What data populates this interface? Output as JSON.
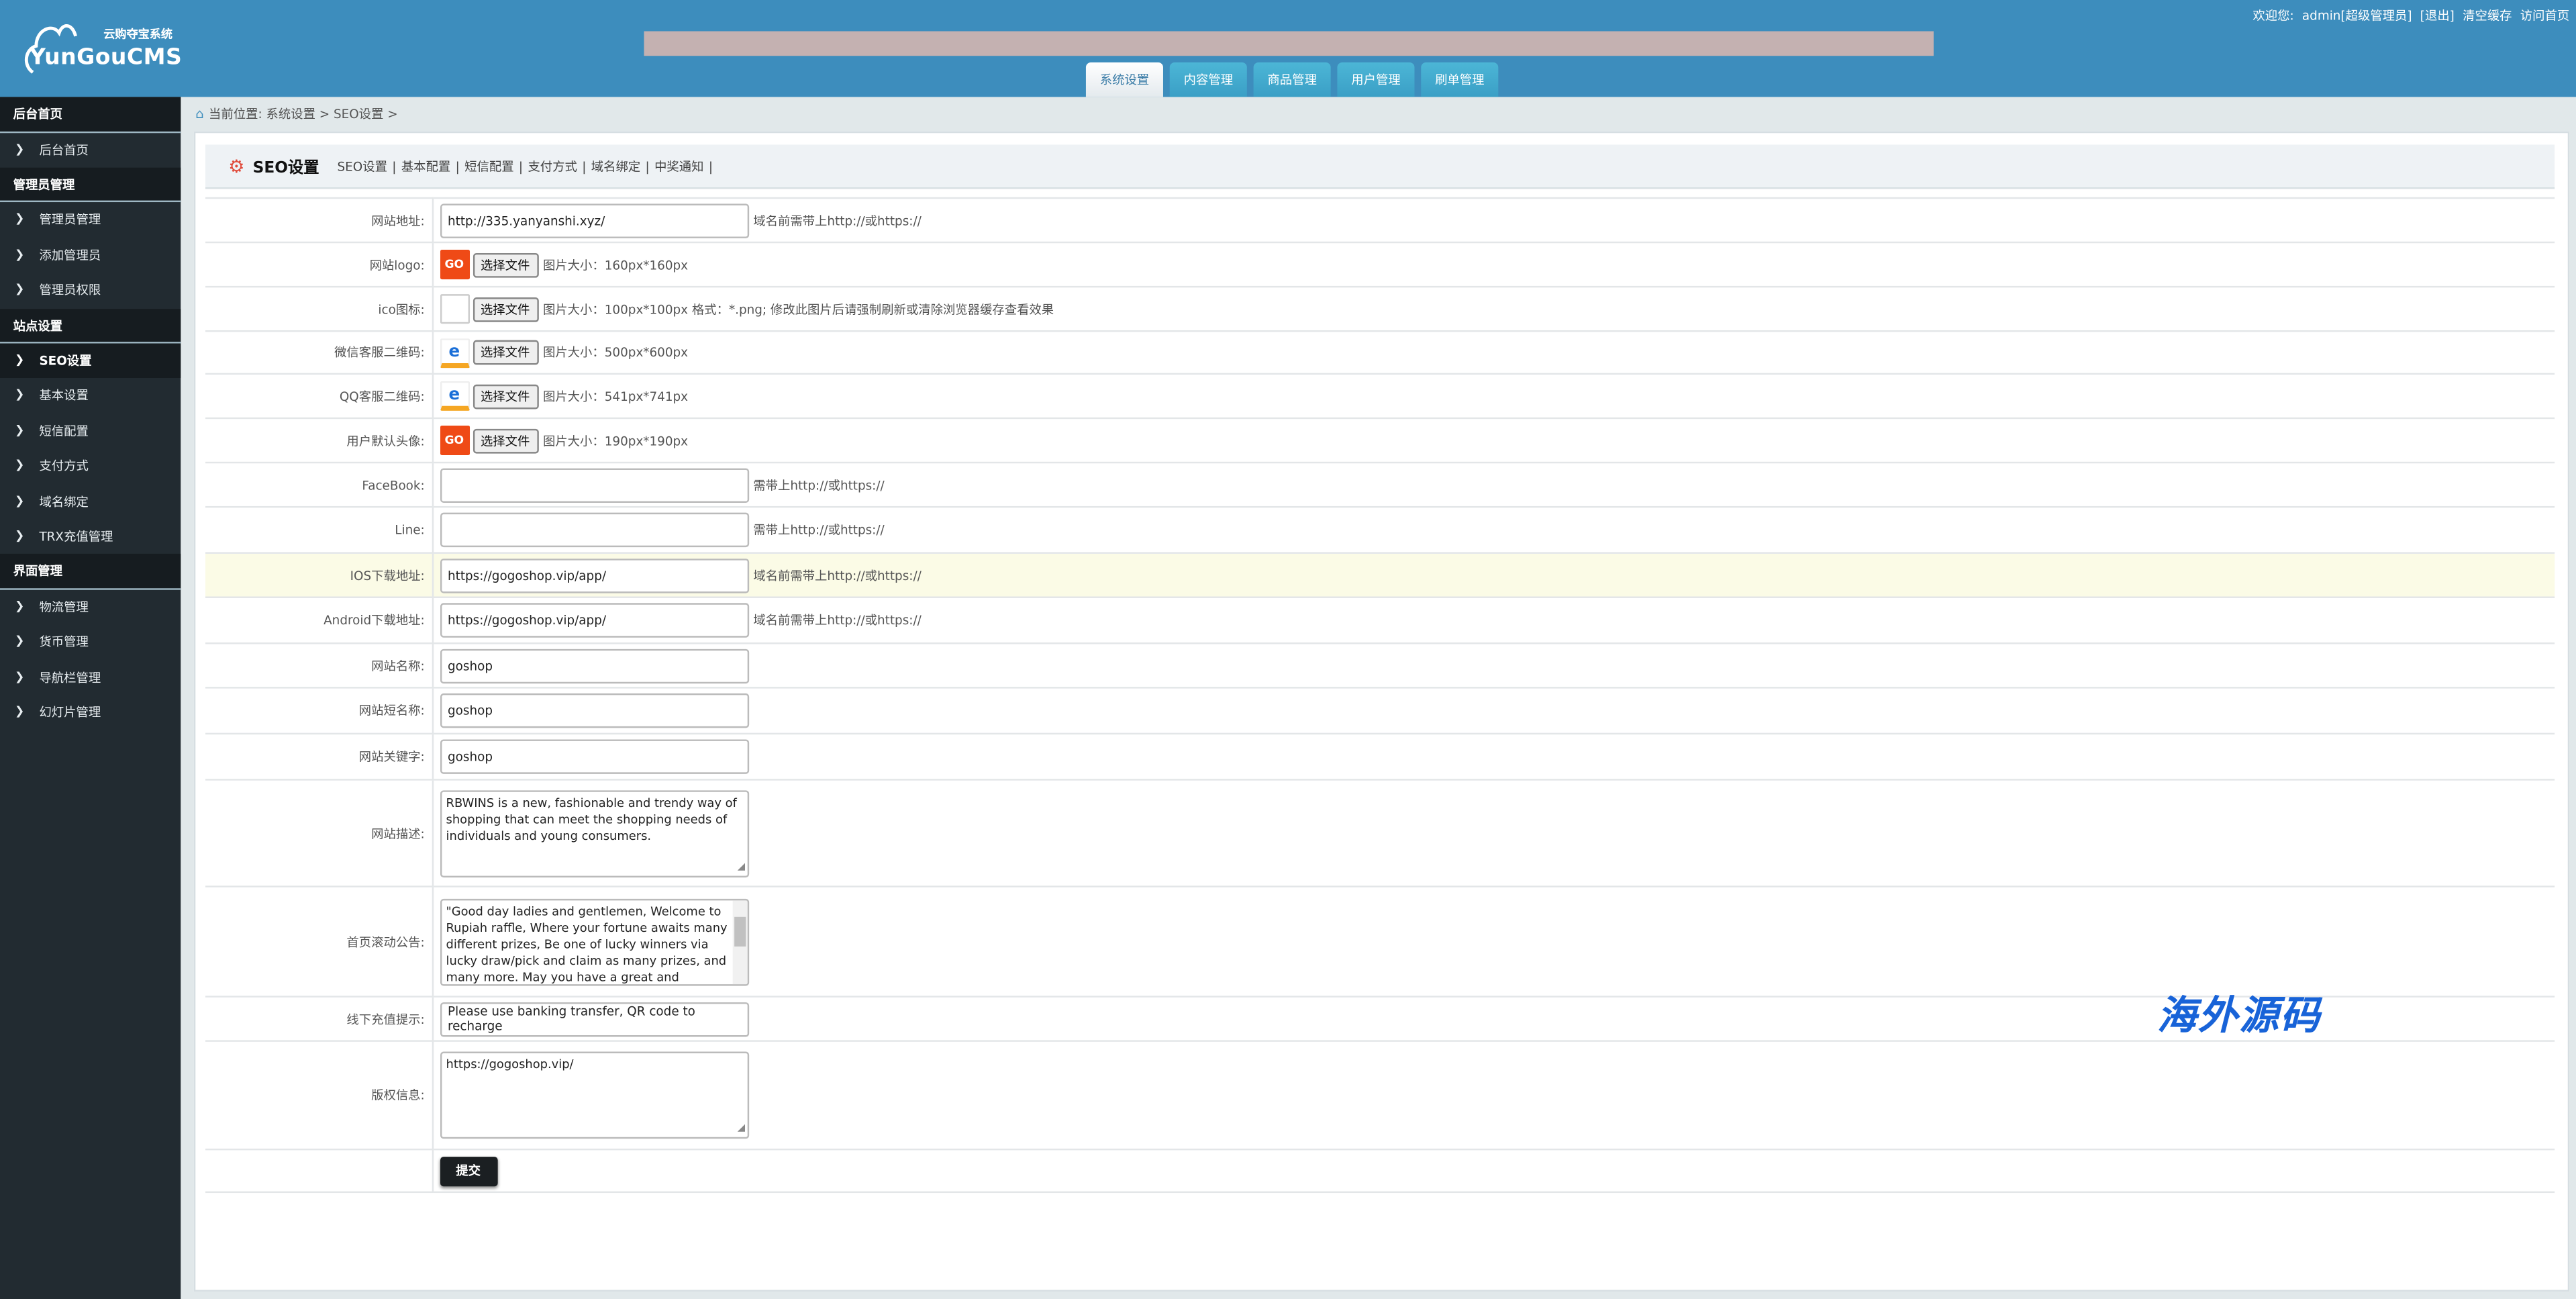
{
  "header": {
    "logo_cn": "云购夺宝系统",
    "logo_en": "YunGouCMS",
    "top_links": [
      "欢迎您:",
      "admin[超级管理员]",
      "[退出]",
      "清空缓存",
      "访问首页"
    ],
    "tabs": [
      {
        "label": "系统设置",
        "active": true
      },
      {
        "label": "内容管理"
      },
      {
        "label": "商品管理"
      },
      {
        "label": "用户管理"
      },
      {
        "label": "刷单管理"
      }
    ],
    "brand_color": "#3d8dbd"
  },
  "sidebar": {
    "sections": [
      {
        "title": "后台首页",
        "items": [
          "后台首页"
        ]
      },
      {
        "title": "管理员管理",
        "items": [
          "管理员管理",
          "添加管理员",
          "管理员权限"
        ]
      },
      {
        "title": "站点设置",
        "items": [
          "SEO设置",
          "基本设置",
          "短信配置",
          "支付方式",
          "域名绑定",
          "TRX充值管理"
        ]
      },
      {
        "title": "界面管理",
        "items": [
          "物流管理",
          "货币管理",
          "导航栏管理",
          "幻灯片管理"
        ]
      }
    ],
    "active": "SEO设置"
  },
  "breadcrumb": "当前位置: 系统设置 > SEO设置 >",
  "page": {
    "title": "SEO设置",
    "links": [
      "SEO设置",
      "基本配置",
      "短信配置",
      "支付方式",
      "域名绑定",
      "中奖通知"
    ]
  },
  "form": {
    "site_url": {
      "label": "网站地址:",
      "value": "http://335.yanyanshi.xyz/",
      "hint": "域名前需带上http://或https://"
    },
    "logo": {
      "label": "网站logo:",
      "button": "选择文件",
      "hint": "图片大小：160px*160px"
    },
    "ico": {
      "label": "ico图标:",
      "button": "选择文件",
      "hint": "图片大小：100px*100px  格式：*.png; 修改此图片后请强制刷新或清除浏览器缓存查看效果"
    },
    "wechat_qr": {
      "label": "微信客服二维码:",
      "button": "选择文件",
      "hint": "图片大小：500px*600px"
    },
    "qq_qr": {
      "label": "QQ客服二维码:",
      "button": "选择文件",
      "hint": "图片大小：541px*741px"
    },
    "avatar": {
      "label": "用户默认头像:",
      "button": "选择文件",
      "hint": "图片大小：190px*190px"
    },
    "facebook": {
      "label": "FaceBook:",
      "value": "",
      "hint": "需带上http://或https://"
    },
    "line": {
      "label": "Line:",
      "value": "",
      "hint": "需带上http://或https://"
    },
    "ios": {
      "label": "IOS下载地址:",
      "value": "https://gogoshop.vip/app/",
      "hint": "域名前需带上http://或https://"
    },
    "android": {
      "label": "Android下载地址:",
      "value": "https://gogoshop.vip/app/",
      "hint": "域名前需带上http://或https://"
    },
    "site_name": {
      "label": "网站名称:",
      "value": "goshop"
    },
    "short_name": {
      "label": "网站短名称:",
      "value": "goshop"
    },
    "keywords": {
      "label": "网站关键字:",
      "value": "goshop"
    },
    "description": {
      "label": "网站描述:",
      "value": "RBWINS is a new, fashionable and trendy way of shopping that can meet the shopping needs of individuals and young consumers."
    },
    "notice": {
      "label": "首页滚动公告:",
      "value": "\"Good day ladies and gentlemen, Welcome to Rupiah raffle, Where your fortune awaits many different prizes, Be one of lucky winners via lucky draw/pick and claim as many prizes, and many more. May you have a great and wonderful day a"
    },
    "offline_tip": {
      "label": "线下充值提示:",
      "value": "Please use banking transfer, QR code to recharge"
    },
    "copyright": {
      "label": "版权信息:",
      "value": "https://gogoshop.vip/"
    },
    "submit": "提交"
  },
  "watermark": "海外源码"
}
